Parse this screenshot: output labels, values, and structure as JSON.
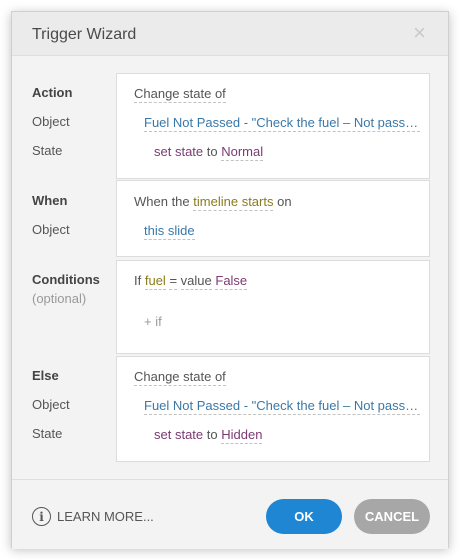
{
  "dialog": {
    "title": "Trigger Wizard",
    "close_symbol": "×"
  },
  "action_section": {
    "label": "Action",
    "object_label": "Object",
    "state_label": "State",
    "action_value": "Change state of",
    "object_value": "Fuel Not Passed - \"Check the fuel – Not passed\"",
    "set_text": "set state",
    "to_text": "to",
    "state_value": "Normal"
  },
  "when_section": {
    "label": "When",
    "object_label": "Object",
    "prefix": "When the",
    "event_value": "timeline starts",
    "on_text": "on",
    "object_value": "this slide"
  },
  "conditions_section": {
    "label": "Conditions",
    "optional_label": "(optional)",
    "if_text": "If",
    "variable": "fuel",
    "operator": "=",
    "value_text": "value",
    "value": "False",
    "add_if": "+ if"
  },
  "else_section": {
    "label": "Else",
    "object_label": "Object",
    "state_label": "State",
    "action_value": "Change state of",
    "object_value": "Fuel Not Passed - \"Check the fuel – Not passed\"",
    "set_text": "set state",
    "to_text": "to",
    "state_value": "Hidden"
  },
  "footer": {
    "info_symbol": "i",
    "learn_more": "LEARN MORE...",
    "ok_label": "OK",
    "cancel_label": "CANCEL"
  },
  "colors": {
    "link_blue": "#3a78a8",
    "olive": "#8a7c1a",
    "purple": "#7b3a73",
    "ok_button": "#1f86d3",
    "cancel_button": "#a7a7a7"
  },
  "icons": {
    "close": "close-icon",
    "info": "info-icon"
  }
}
